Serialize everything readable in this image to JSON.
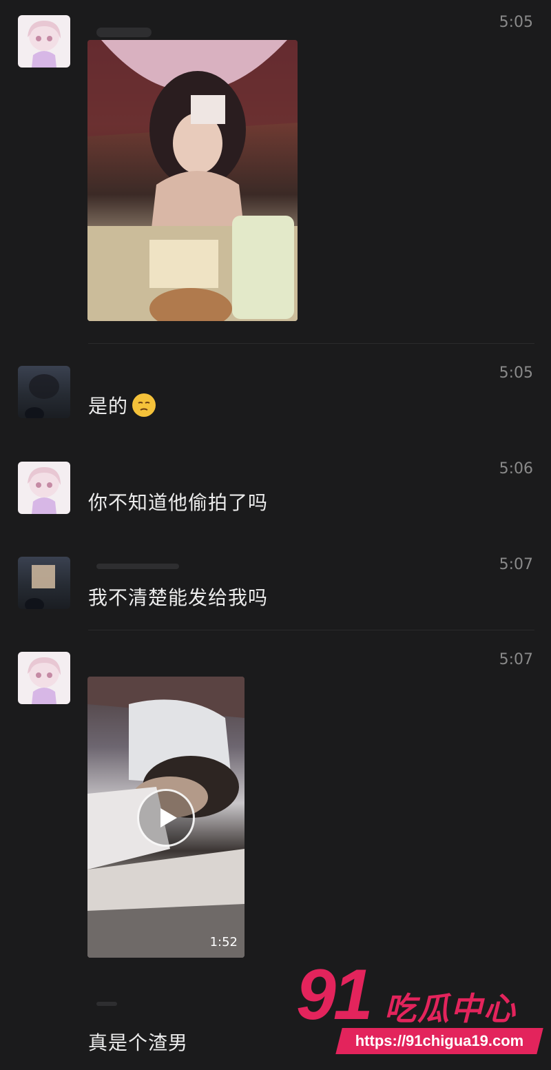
{
  "messages": [
    {
      "time": "5:05",
      "type": "image"
    },
    {
      "time": "5:05",
      "text": "是的",
      "emoji": "pensive-face"
    },
    {
      "time": "5:06",
      "text": "你不知道他偷拍了吗"
    },
    {
      "time": "5:07",
      "text": "我不清楚能发给我吗"
    },
    {
      "time": "5:07",
      "type": "video",
      "duration": "1:52"
    },
    {
      "text": "真是个渣男"
    }
  ],
  "watermark": {
    "number": "91",
    "name": "吃瓜中心",
    "url": "https://91chigua19.com"
  },
  "colors": {
    "background": "#1b1b1c",
    "watermark": "#e3245c"
  }
}
